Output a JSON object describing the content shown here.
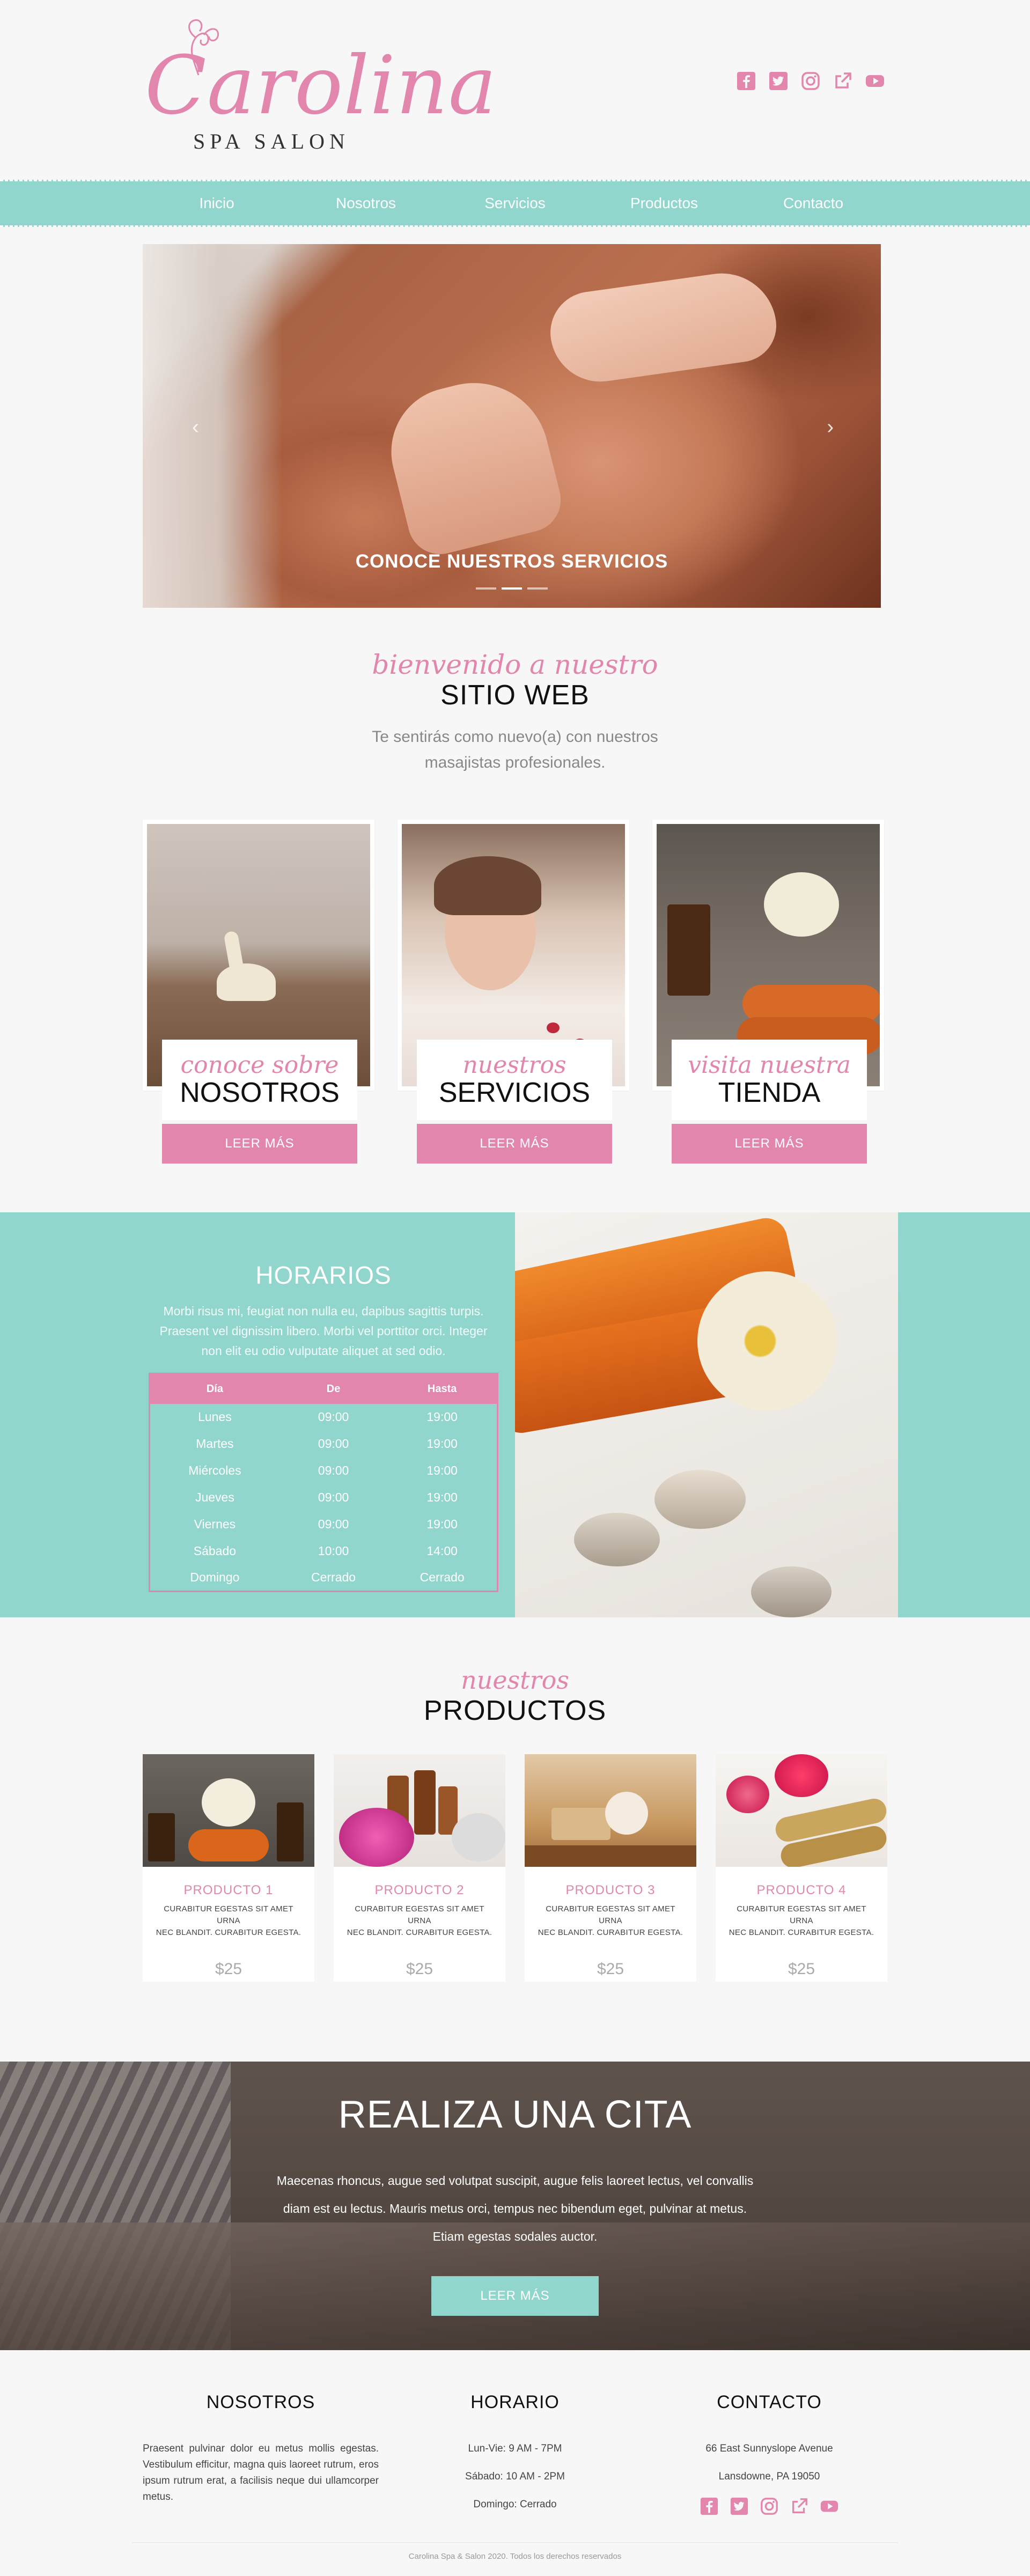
{
  "colors": {
    "pink": "#e386ae",
    "teal": "#91d6cc",
    "dark": "#111111"
  },
  "logo": {
    "script": "Carolina",
    "sub": "SPA SALON"
  },
  "social": [
    {
      "name": "facebook-icon"
    },
    {
      "name": "twitter-icon"
    },
    {
      "name": "instagram-icon"
    },
    {
      "name": "external-link-icon"
    },
    {
      "name": "youtube-icon"
    }
  ],
  "nav": [
    "Inicio",
    "Nosotros",
    "Servicios",
    "Productos",
    "Contacto"
  ],
  "slider": {
    "caption": "CONOCE NUESTROS SERVICIOS",
    "prev": "‹",
    "next": "›",
    "active_dot": 1,
    "dot_count": 3
  },
  "welcome": {
    "script": "bienvenido a nuestro",
    "title": "SITIO WEB",
    "line1": "Te sentirás como nuevo(a) con nuestros",
    "line2": "masajistas profesionales."
  },
  "cards": [
    {
      "script": "conoce sobre",
      "title": "NOSOTROS",
      "button": "LEER MÁS"
    },
    {
      "script": "nuestros",
      "title": "SERVICIOS",
      "button": "LEER MÁS"
    },
    {
      "script": "visita nuestra",
      "title": "TIENDA",
      "button": "LEER MÁS"
    }
  ],
  "hours": {
    "title": "HORARIOS",
    "text1": "Morbi risus mi, feugiat non nulla eu, dapibus sagittis turpis.",
    "text2": "Praesent vel dignissim libero. Morbi vel porttitor orci. Integer",
    "text3": "non elit eu odio vulputate aliquet at sed odio.",
    "headers": [
      "Día",
      "De",
      "Hasta"
    ],
    "rows": [
      [
        "Lunes",
        "09:00",
        "19:00"
      ],
      [
        "Martes",
        "09:00",
        "19:00"
      ],
      [
        "Miércoles",
        "09:00",
        "19:00"
      ],
      [
        "Jueves",
        "09:00",
        "19:00"
      ],
      [
        "Viernes",
        "09:00",
        "19:00"
      ],
      [
        "Sábado",
        "10:00",
        "14:00"
      ],
      [
        "Domingo",
        "Cerrado",
        "Cerrado"
      ]
    ]
  },
  "products": {
    "script": "nuestros",
    "title": "PRODUCTOS",
    "items": [
      {
        "name": "PRODUCTO 1",
        "desc1": "CURABITUR EGESTAS SIT AMET URNA",
        "desc2": "NEC BLANDIT. CURABITUR EGESTA.",
        "price": "$25"
      },
      {
        "name": "PRODUCTO 2",
        "desc1": "CURABITUR EGESTAS SIT AMET URNA",
        "desc2": "NEC BLANDIT. CURABITUR EGESTA.",
        "price": "$25"
      },
      {
        "name": "PRODUCTO 3",
        "desc1": "CURABITUR EGESTAS SIT AMET URNA",
        "desc2": "NEC BLANDIT. CURABITUR EGESTA.",
        "price": "$25"
      },
      {
        "name": "PRODUCTO 4",
        "desc1": "CURABITUR EGESTAS SIT AMET URNA",
        "desc2": "NEC BLANDIT. CURABITUR EGESTA.",
        "price": "$25"
      }
    ]
  },
  "cita": {
    "title": "REALIZA UNA CITA",
    "line1": "Maecenas rhoncus, augue sed volutpat suscipit, augue felis laoreet lectus, vel convallis",
    "line2": "diam est eu lectus. Mauris metus orci, tempus nec bibendum eget, pulvinar at metus.",
    "line3": "Etiam egestas sodales auctor.",
    "button": "LEER MÁS"
  },
  "footer": {
    "about_title": "NOSOTROS",
    "about_text": "Praesent pulvinar dolor eu metus mollis egestas. Vestibulum efficitur, magna quis laoreet rutrum, eros ipsum rutrum erat, a facilisis neque dui ullamcorper metus.",
    "hours_title": "HORARIO",
    "hours_lines": [
      "Lun-Vie: 9 AM - 7PM",
      "Sábado: 10 AM - 2PM",
      "Domingo: Cerrado"
    ],
    "contact_title": "CONTACTO",
    "contact_lines": [
      "66 East Sunnyslope Avenue",
      "Lansdowne, PA 19050"
    ],
    "copyright": "Carolina Spa & Salon 2020. Todos los derechos reservados"
  }
}
